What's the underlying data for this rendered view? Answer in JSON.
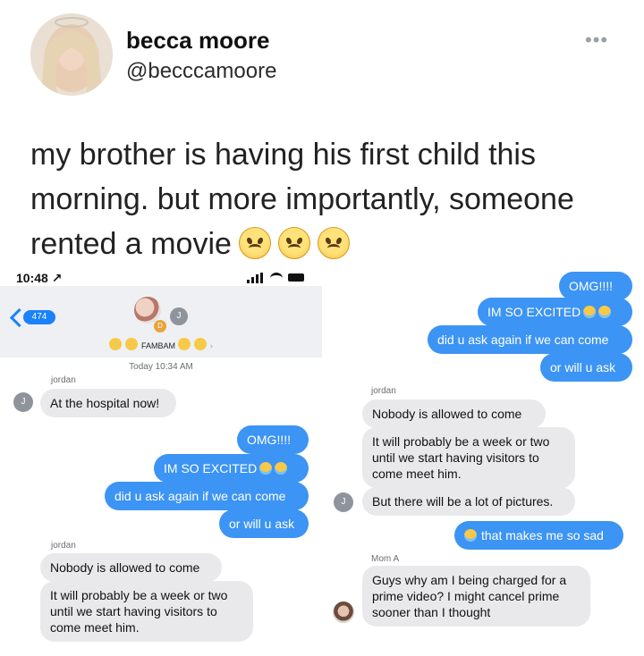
{
  "tweet": {
    "name": "becca moore",
    "handle": "@becccamoore",
    "more_icon": "more-dots-icon",
    "text": "my brother is having his first child this morning. but more importantly, someone rented a movie",
    "emoji": [
      "angry-face",
      "angry-face",
      "angry-face"
    ]
  },
  "left_screen": {
    "status_time": "10:48 ↗",
    "back_count": "474",
    "group_avatars": {
      "second": "J",
      "third": "D"
    },
    "group_name": "FAMBAM",
    "timestamp": "Today 10:34 AM",
    "sender1": "jordan",
    "avatar1": "J",
    "msg1": "At the hospital now!",
    "out1": "OMG!!!!",
    "out2": "IM SO EXCITED",
    "out3": "did u ask again if we can come",
    "out4": "or will u ask",
    "sender2": "jordan",
    "msg2": "Nobody is allowed to come",
    "msg3": "It will probably be a week or two until we start having visitors to come meet him."
  },
  "right_screen": {
    "out1": "OMG!!!!",
    "out2": "IM SO EXCITED",
    "out3": "did u ask again if we can come",
    "out4": "or will u ask",
    "sender1": "jordan",
    "msg1": "Nobody is allowed to come",
    "msg2": "It will probably be a week or two until we start having visitors to come meet him.",
    "avatar1": "J",
    "msg3": "But there will be a lot of pictures.",
    "out5": "that makes me so sad",
    "sender2": "Mom A",
    "msg4": "Guys why am I being charged for a prime video? I might cancel prime sooner than I thought"
  },
  "colors": {
    "outgoing_bubble": "#3c94f4",
    "incoming_bubble": "#e9e9eb",
    "accent": "#1a82fb"
  }
}
